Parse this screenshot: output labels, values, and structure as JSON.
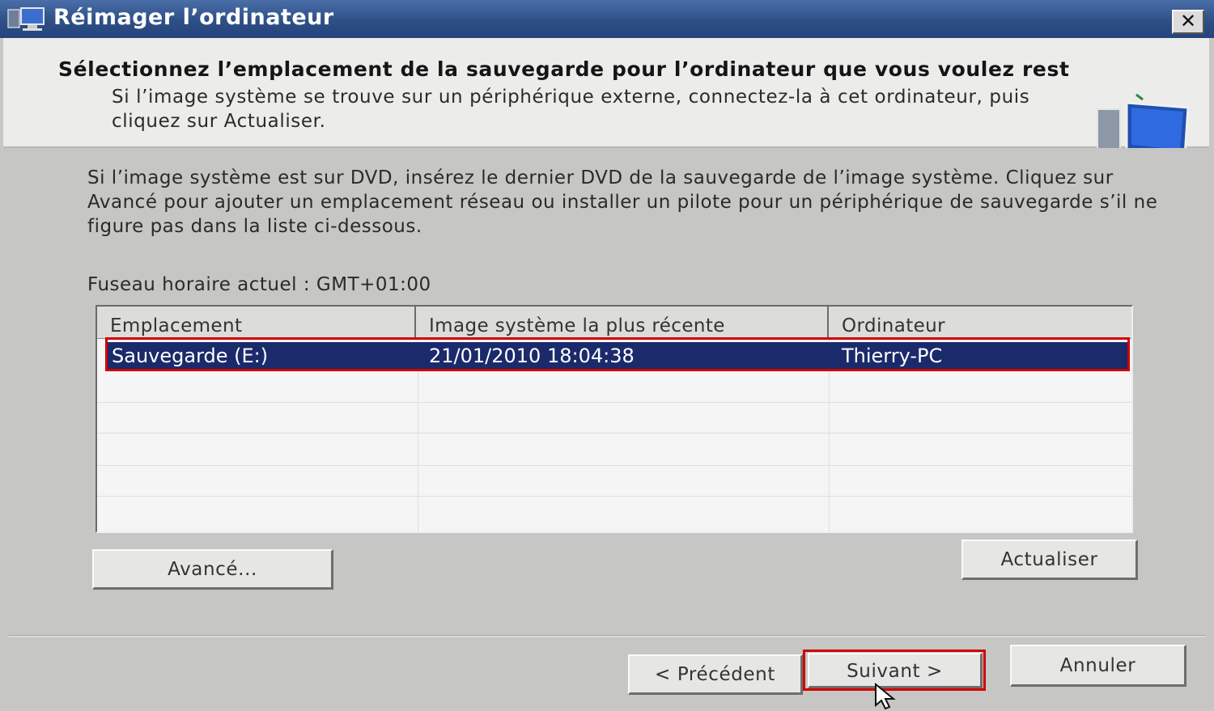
{
  "window": {
    "title": "Réimager l’ordinateur",
    "close_label": "✕"
  },
  "header": {
    "heading": "Sélectionnez l’emplacement de la sauvegarde pour l’ordinateur que vous voulez rest",
    "subtext": "Si l’image système se trouve sur un périphérique externe, connectez-la à cet ordinateur, puis cliquez sur Actualiser."
  },
  "main": {
    "info": "Si l’image système est sur DVD, insérez le dernier DVD de la sauvegarde de l’image système. Cliquez sur Avancé pour ajouter un emplacement réseau ou installer un pilote pour un périphérique de sauvegarde s’il ne figure pas dans la liste ci-dessous.",
    "timezone": "Fuseau horaire actuel : GMT+01:00"
  },
  "table": {
    "columns": [
      "Emplacement",
      "Image système la plus récente",
      "Ordinateur"
    ],
    "rows": [
      {
        "location": "Sauvegarde (E:)",
        "date": "21/01/2010 18:04:38",
        "computer": "Thierry-PC",
        "selected": true
      }
    ]
  },
  "buttons": {
    "advanced": "Avancé...",
    "refresh": "Actualiser",
    "previous": "< Précédent",
    "next": "Suivant >",
    "cancel": "Annuler"
  },
  "colors": {
    "titlebar": "#2e4f86",
    "selection": "#1b2a6b",
    "highlight": "#d10000"
  }
}
